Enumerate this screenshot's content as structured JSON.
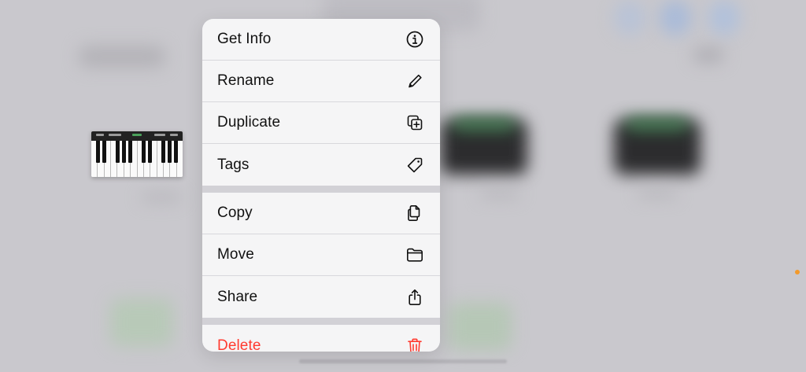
{
  "menu": {
    "groups": [
      {
        "items": [
          {
            "label": "Get Info",
            "icon": "info-circle-icon"
          },
          {
            "label": "Rename",
            "icon": "pencil-icon"
          },
          {
            "label": "Duplicate",
            "icon": "duplicate-icon"
          },
          {
            "label": "Tags",
            "icon": "tag-icon"
          }
        ]
      },
      {
        "items": [
          {
            "label": "Copy",
            "icon": "copy-documents-icon"
          },
          {
            "label": "Move",
            "icon": "folder-icon"
          },
          {
            "label": "Share",
            "icon": "share-icon"
          }
        ]
      },
      {
        "items": [
          {
            "label": "Delete",
            "icon": "trash-icon",
            "color": "#ff3b30"
          }
        ]
      }
    ]
  },
  "colors": {
    "background": "#c9c8cd",
    "menu_background": "#f6f6f7",
    "destructive": "#ff3b30",
    "indicator": "#f39a2b"
  },
  "thumbnail": {
    "icon": "piano-keyboard-icon"
  }
}
